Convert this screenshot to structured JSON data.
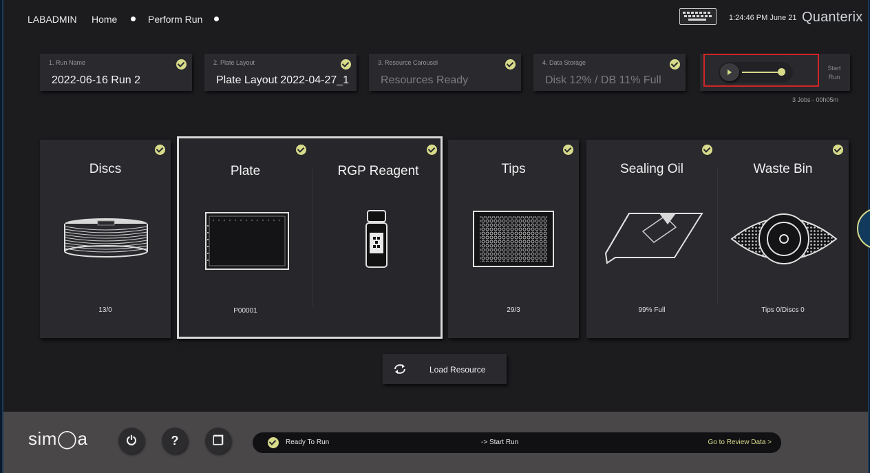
{
  "nav": {
    "user": "LABADMIN",
    "home": "Home",
    "perform_run": "Perform Run",
    "time": "1:24:46 PM  June 21",
    "brand": "Quanterix"
  },
  "steps": [
    {
      "label": "1. Run Name",
      "value": "2022-06-16 Run 2"
    },
    {
      "label": "2. Plate Layout",
      "value": "Plate Layout 2022-04-27_1"
    },
    {
      "label": "3. Resource Carousel",
      "value": "Resources Ready"
    },
    {
      "label": "4. Data Storage",
      "value": "Disk 12% / DB 11% Full"
    }
  ],
  "start": {
    "label_line1": "Start",
    "label_line2": "Run",
    "jobs": "3 Jobs - 00h05m"
  },
  "resources": [
    {
      "title": "Discs",
      "value": "13/0"
    },
    {
      "title": "Plate",
      "value": "P00001"
    },
    {
      "title": "RGP Reagent",
      "value": ""
    },
    {
      "title": "Tips",
      "value": "29/3"
    },
    {
      "title": "Sealing Oil",
      "value": "99% Full"
    },
    {
      "title": "Waste Bin",
      "value": "Tips 0/Discs 0"
    }
  ],
  "load_resource": "Load Resource",
  "bottom": {
    "logo": "sim◯a",
    "power_icon": "⏻",
    "help_label": "?",
    "copy_icon": "❐",
    "status": "Ready To Run",
    "middle": "-> Start Run",
    "link": "Go to Review Data >"
  },
  "colors": {
    "accent": "#d7db8a",
    "highlight": "#d22525",
    "panel": "#2a2a2e"
  }
}
